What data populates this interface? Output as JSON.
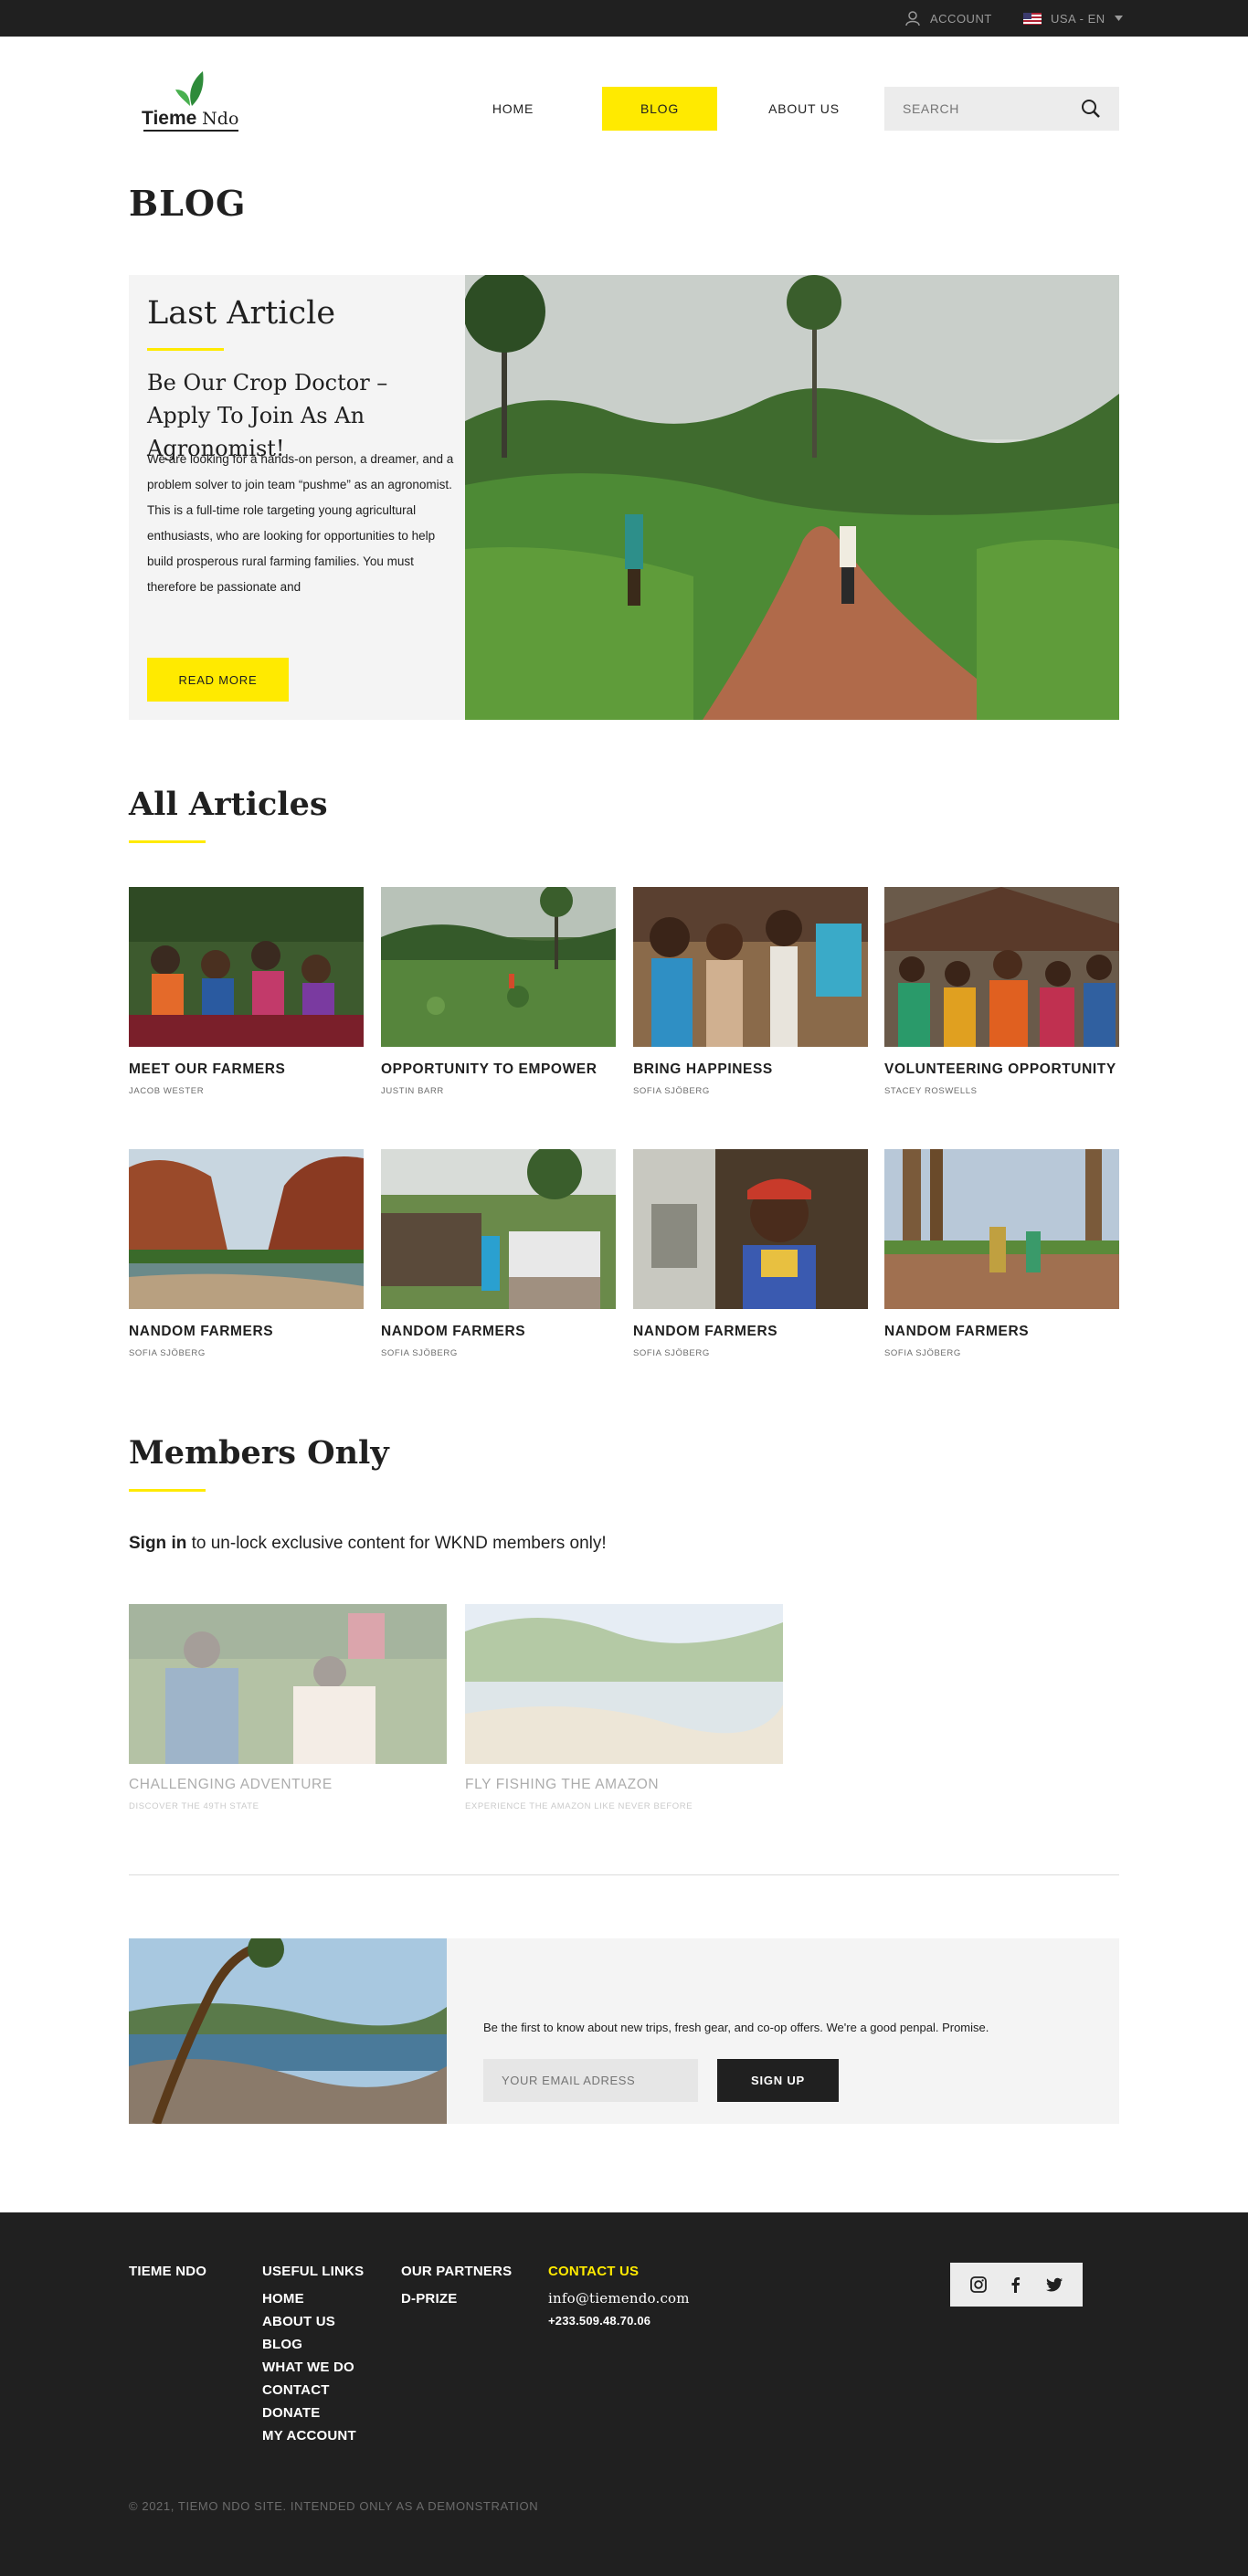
{
  "topbar": {
    "account_label": "ACCOUNT",
    "language_label": "USA - EN"
  },
  "header": {
    "logo_text_bold": "Tieme",
    "logo_text_light": "Ndo",
    "nav": [
      {
        "label": "HOME"
      },
      {
        "label": "BLOG",
        "active": true
      },
      {
        "label": "ABOUT US"
      }
    ],
    "search_placeholder": "SEARCH"
  },
  "page_title": "BLOG",
  "featured": {
    "label": "Last Article",
    "headline": "Be Our Crop Doctor – Apply To Join As An Agronomist!",
    "excerpt": "We are looking for a hands-on person, a dreamer, and a problem solver to join team “pushme” as an agronomist. This is a full-time role targeting young agricultural enthusiasts, who are looking for opportunities to help build prosperous rural farming families. You must therefore be passionate and",
    "button_label": "READ MORE"
  },
  "all_articles": {
    "title": "All Articles",
    "items": [
      {
        "title": "MEET OUR FARMERS",
        "author": "JACOB WESTER"
      },
      {
        "title": "OPPORTUNITY TO EMPOWER",
        "author": "JUSTIN BARR"
      },
      {
        "title": "BRING HAPPINESS",
        "author": "SOFIA SJÖBERG"
      },
      {
        "title": "VOLUNTEERING OPPORTUNITY",
        "author": "STACEY ROSWELLS"
      },
      {
        "title": "NANDOM FARMERS",
        "author": "SOFIA SJÖBERG"
      },
      {
        "title": "NANDOM FARMERS",
        "author": "SOFIA SJÖBERG"
      },
      {
        "title": "NANDOM FARMERS",
        "author": "SOFIA SJÖBERG"
      },
      {
        "title": "NANDOM FARMERS",
        "author": "SOFIA SJÖBERG"
      }
    ]
  },
  "members": {
    "title": "Members Only",
    "sign_in_label": "Sign in",
    "description": " to un-lock exclusive content for WKND members only!",
    "items": [
      {
        "title": "CHALLENGING ADVENTURE",
        "subtitle": "DISCOVER THE 49TH STATE"
      },
      {
        "title": "FLY FISHING THE AMAZON",
        "subtitle": "EXPERIENCE THE AMAZON LIKE NEVER BEFORE"
      }
    ]
  },
  "newsletter": {
    "text": "Be the first to know about new trips, fresh gear, and co-op offers. We're a good penpal. Promise.",
    "email_placeholder": "YOUR EMAIL ADRESS",
    "button_label": "SIGN UP"
  },
  "footer": {
    "brand": "TIEME NDO",
    "useful_links_heading": "USEFUL LINKS",
    "useful_links": [
      "HOME",
      "ABOUT US",
      "BLOG",
      "WHAT WE DO",
      "CONTACT",
      "DONATE",
      "MY ACCOUNT"
    ],
    "partners_heading": "OUR PARTNERS",
    "partners": [
      "D-PRIZE"
    ],
    "contact_heading": "CONTACT US",
    "email": "info@tiemendo.com",
    "phone": "+233.509.48.70.06",
    "social_icons": [
      "instagram-icon",
      "facebook-icon",
      "twitter-icon"
    ],
    "copyright": "© 2021, TIEMO NDO SITE. INTENDED ONLY AS A DEMONSTRATION"
  },
  "colors": {
    "accent": "#ffea00",
    "dark": "#202020",
    "light_panel": "#f4f4f4"
  }
}
